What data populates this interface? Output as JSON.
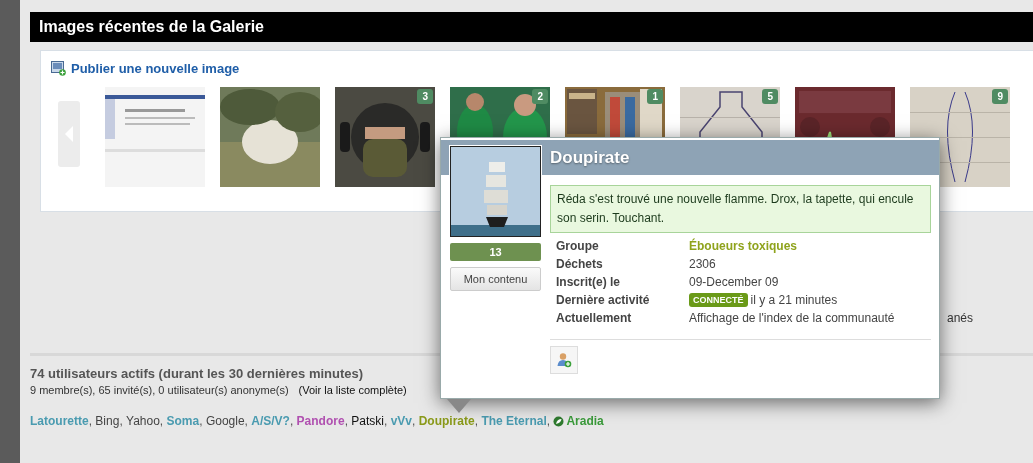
{
  "gallery": {
    "title": "Images récentes de la Galerie",
    "publish_link": "Publier une nouvelle image",
    "thumbnails": [
      {
        "kind": "picture"
      },
      {
        "kind": "picture"
      },
      {
        "kind": "picture",
        "badge": "3"
      },
      {
        "kind": "picture",
        "badge": "2"
      },
      {
        "kind": "picture",
        "badge": "1"
      },
      {
        "kind": "picture",
        "badge": "5"
      },
      {
        "kind": "picture"
      },
      {
        "kind": "picture",
        "badge": "9"
      }
    ]
  },
  "hidden_text": "anés",
  "active_users": {
    "heading": "74 utilisateurs actifs (durant les 30 dernières minutes)",
    "summary": "9 membre(s), 65 invité(s), 0 utilisateur(s) anonyme(s)",
    "full_list_link": "(Voir la liste complète)",
    "separator": ",",
    "users": [
      {
        "name": "Latourette",
        "bold": true,
        "color": "#4a9bb0",
        "has_icon": false
      },
      {
        "name": "Bing",
        "bold": false,
        "color": "#444444",
        "has_icon": false
      },
      {
        "name": "Yahoo",
        "bold": false,
        "color": "#444444",
        "has_icon": false
      },
      {
        "name": "Soma",
        "bold": true,
        "color": "#4a9bb0",
        "has_icon": false
      },
      {
        "name": "Google",
        "bold": false,
        "color": "#444444",
        "has_icon": false
      },
      {
        "name": "A/S/V?",
        "bold": true,
        "color": "#4a9bb0",
        "has_icon": false
      },
      {
        "name": "Pandore",
        "bold": true,
        "color": "#b050b0",
        "has_icon": false
      },
      {
        "name": "Patski",
        "bold": false,
        "color": "#111111",
        "has_icon": false
      },
      {
        "name": "vVv",
        "bold": true,
        "color": "#4a9bb0",
        "has_icon": false
      },
      {
        "name": "Doupirate",
        "bold": true,
        "color": "#8a9a1a",
        "has_icon": false
      },
      {
        "name": "The Eternal",
        "bold": true,
        "color": "#4a9bb0",
        "has_icon": false
      },
      {
        "name": "Aradia",
        "bold": true,
        "color": "#3a9a3a",
        "has_icon": true
      }
    ]
  },
  "profile_card": {
    "name": "Doupirate",
    "count": "13",
    "content_button": "Mon contenu",
    "status_message": "Réda s'est trouvé une nouvelle flamme. Drox, la tapette, qui encule son serin. Touchant.",
    "fields": [
      {
        "kind": "group",
        "label": "Groupe",
        "value": "Éboueurs toxiques",
        "color": "#8fa31c"
      },
      {
        "kind": "text",
        "label": "Déchets",
        "value": "2306"
      },
      {
        "kind": "text",
        "label": "Inscrit(e) le",
        "value": "09-December 09"
      },
      {
        "kind": "status",
        "label": "Dernière activité",
        "badge": "CONNECTÉ",
        "value": "il y a 21 minutes"
      },
      {
        "kind": "text",
        "label": "Actuellement",
        "value": "Affichage de l'index de la communauté"
      }
    ]
  }
}
